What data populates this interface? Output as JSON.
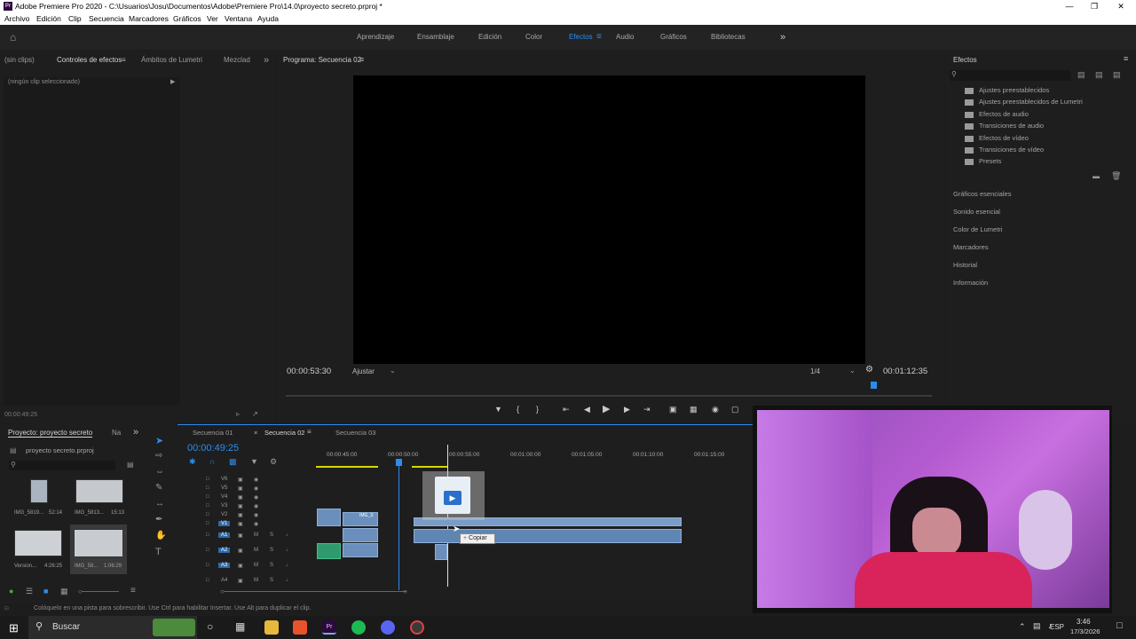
{
  "window": {
    "title": "Adobe Premiere Pro 2020 - C:\\Usuarios\\Josu\\Documentos\\Adobe\\Premiere Pro\\14.0\\proyecto secreto.prproj *",
    "app_icon": "Pr"
  },
  "menu": [
    "Archivo",
    "Edición",
    "Clip",
    "Secuencia",
    "Marcadores",
    "Gráficos",
    "Ver",
    "Ventana",
    "Ayuda"
  ],
  "workspaces": {
    "items": [
      "Aprendizaje",
      "Ensamblaje",
      "Edición",
      "Color",
      "Efectos",
      "Audio",
      "Gráficos",
      "Bibliotecas"
    ],
    "active": "Efectos"
  },
  "source_panel": {
    "tabs": [
      "(sin clips)",
      "Controles de efectos",
      "Ámbitos de Lumetri",
      "Mezclad"
    ],
    "active_tab": "Controles de efectos",
    "no_clip": "(ningún clip seleccionado)",
    "timecode": "00:00:49:25"
  },
  "program": {
    "title": "Programa: Secuencia 02",
    "timecode_left": "00:00:53:30",
    "fit": "Ajustar",
    "resolution": "1/4",
    "timecode_right": "00:01:12:35",
    "playhead_fraction": 0.91
  },
  "effects_panel": {
    "title": "Efectos",
    "search_placeholder": "",
    "folders": [
      "Ajustes preestablecidos",
      "Ajustes preestablecidos de Lumetri",
      "Efectos de audio",
      "Transiciones de audio",
      "Efectos de vídeo",
      "Transiciones de vídeo",
      "Presets"
    ],
    "side_panels": [
      "Gráficos esenciales",
      "Sonido esencial",
      "Color de Lumetri",
      "Marcadores",
      "Historial",
      "Información"
    ]
  },
  "project_panel": {
    "tabs": [
      "Proyecto: proyecto secreto",
      "Na"
    ],
    "file": "proyecto secreto.prproj",
    "items": [
      {
        "name": "IMG_5819...",
        "duration": "52:14"
      },
      {
        "name": "IMG_5813...",
        "duration": "15:13"
      },
      {
        "name": "Version...",
        "duration": "4:26:25"
      },
      {
        "name": "IMG_58...",
        "duration": "1:06:29"
      }
    ]
  },
  "timeline": {
    "tabs": [
      "Secuencia 01",
      "Secuencia 02",
      "Secuencia 03"
    ],
    "active_tab": "Secuencia 02",
    "timecode": "00:00:49:25",
    "ruler": [
      "00:00:45:00",
      "00:00:50:00",
      "00:00:55:00",
      "00:01:00:00",
      "00:01:05:00",
      "00:01:10:00",
      "00:01:15:00"
    ],
    "video_tracks": [
      "V6",
      "V5",
      "V4",
      "V3",
      "V2",
      "V1"
    ],
    "audio_tracks": [
      "A1",
      "A2",
      "A3",
      "A4"
    ],
    "track_m": "M",
    "track_s": "S",
    "clip_label": "IMG_S",
    "drag_tooltip": "Copiar"
  },
  "status_bar": "Colóquelo en una pista para sobrescribir. Use Ctrl para habilitar Insertar. Use Alt para duplicar el clip.",
  "taskbar": {
    "search": "Buscar",
    "lang": "ESP",
    "time": "3:46",
    "date": "17/3/2026"
  },
  "colors": {
    "accent": "#2d8ceb",
    "video_clip": "#6a8fbd",
    "audio_clip": "#2f9a6e",
    "webcam_overlay": "#b45ad0"
  }
}
